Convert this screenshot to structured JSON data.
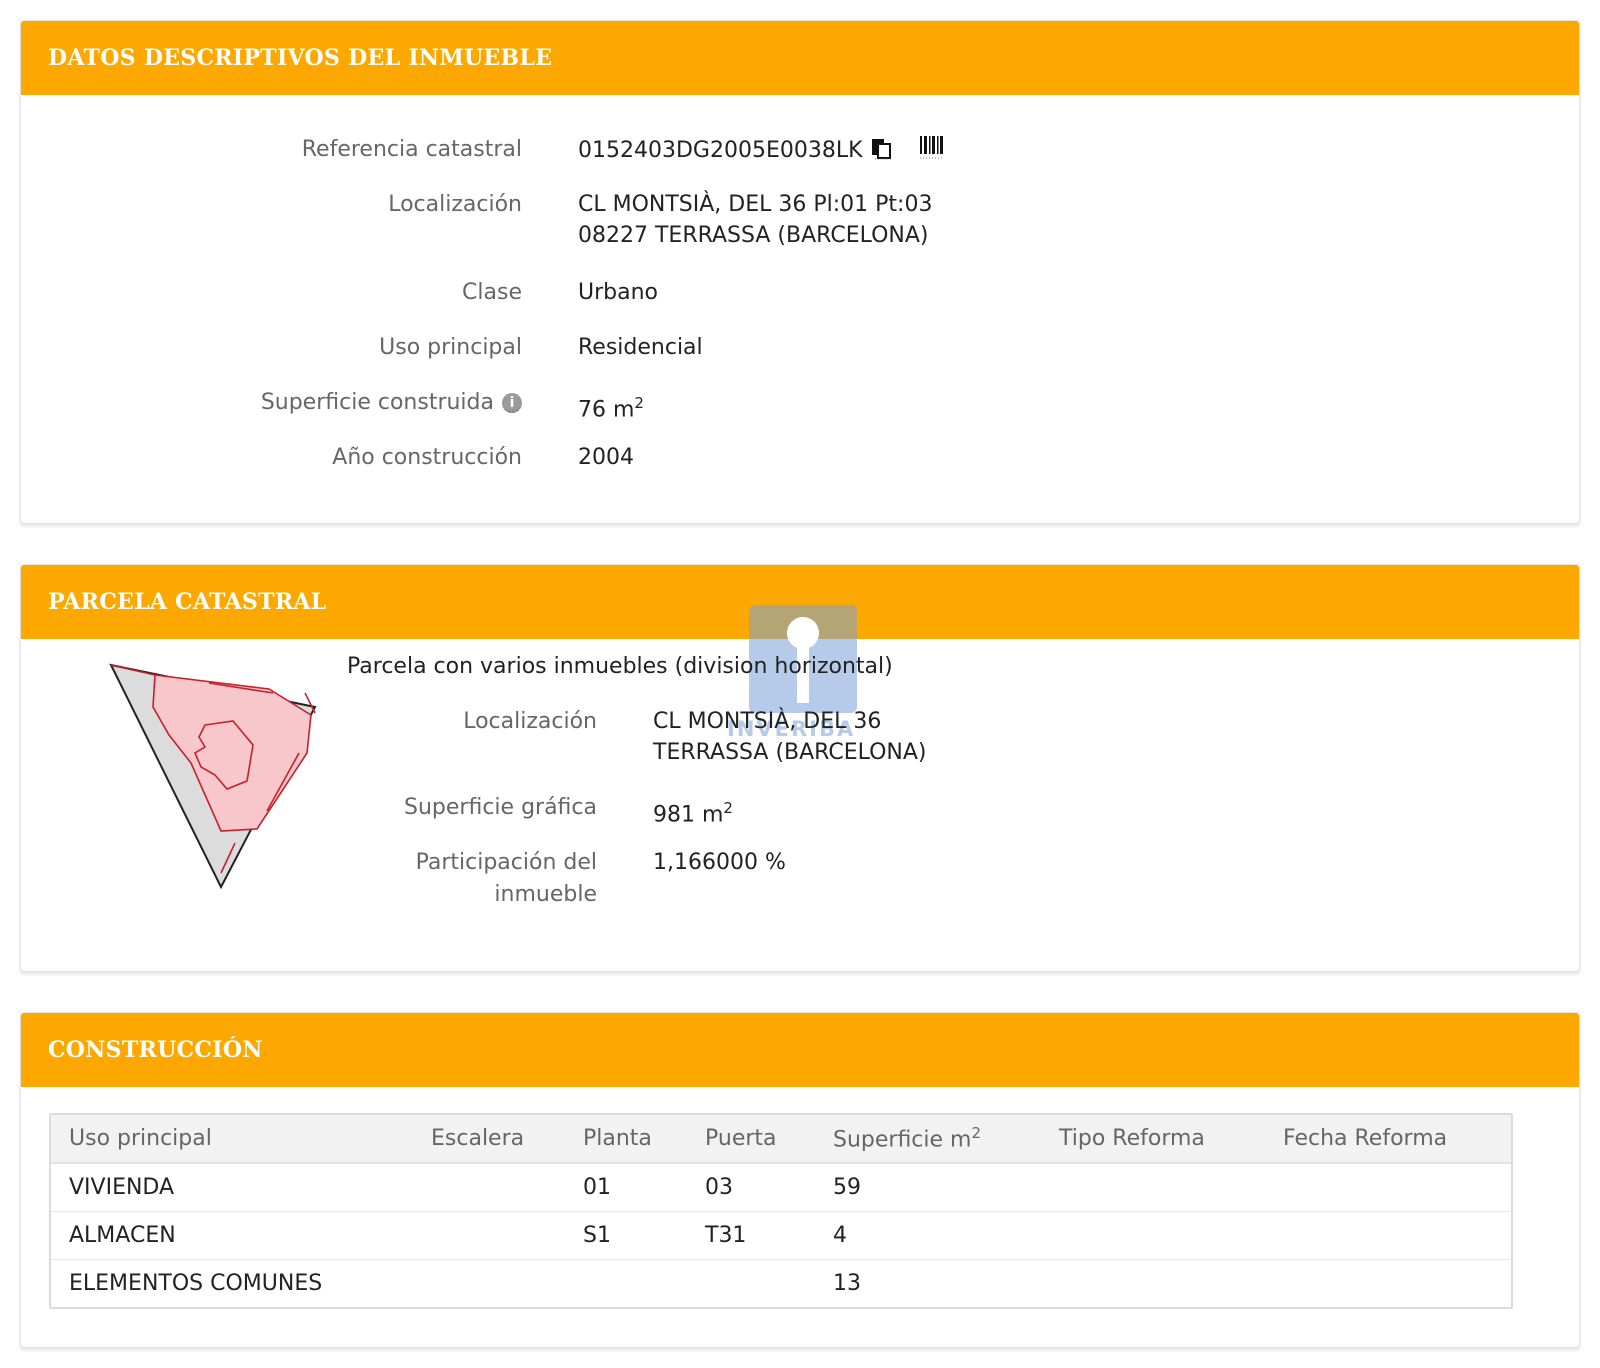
{
  "descriptivos": {
    "title": "DATOS DESCRIPTIVOS DEL INMUEBLE",
    "referencia_label": "Referencia catastral",
    "referencia_value": "0152403DG2005E0038LK",
    "localizacion_label": "Localización",
    "localizacion_line1": "CL MONTSIÀ, DEL 36 Pl:01 Pt:03",
    "localizacion_line2": "08227 TERRASSA (BARCELONA)",
    "clase_label": "Clase",
    "clase_value": "Urbano",
    "uso_label": "Uso principal",
    "uso_value": "Residencial",
    "superficie_label": "Superficie construida",
    "superficie_value": "76 m",
    "superficie_exp": "2",
    "anio_label": "Año construcción",
    "anio_value": "2004",
    "info_glyph": "i"
  },
  "parcela": {
    "title": "PARCELA CATASTRAL",
    "subtitle": "Parcela con varios inmuebles (division horizontal)",
    "localizacion_label": "Localización",
    "localizacion_line1": "CL MONTSIÀ, DEL 36",
    "localizacion_line2": "TERRASSA (BARCELONA)",
    "superficie_label": "Superficie gráfica",
    "superficie_value": "981 m",
    "superficie_exp": "2",
    "participacion_label_line1": "Participación del",
    "participacion_label_line2": "inmueble",
    "participacion_value": "1,166000 %",
    "watermark_text": "INVERIBA"
  },
  "construccion": {
    "title": "CONSTRUCCIÓN",
    "headers": [
      "Uso principal",
      "Escalera",
      "Planta",
      "Puerta",
      "Superficie m",
      "Tipo Reforma",
      "Fecha Reforma"
    ],
    "superficie_exp": "2",
    "rows": [
      [
        "VIVIENDA",
        "",
        "01",
        "03",
        "59",
        "",
        ""
      ],
      [
        "ALMACEN",
        "",
        "S1",
        "T31",
        "4",
        "",
        ""
      ],
      [
        "ELEMENTOS COMUNES",
        "",
        "",
        "",
        "13",
        "",
        ""
      ]
    ]
  },
  "icons": {
    "copy": "copy-icon",
    "barcode": "barcode-icon",
    "info": "info-icon",
    "parcel_map": "parcel-map-icon",
    "watermark": "keyhole-icon"
  }
}
